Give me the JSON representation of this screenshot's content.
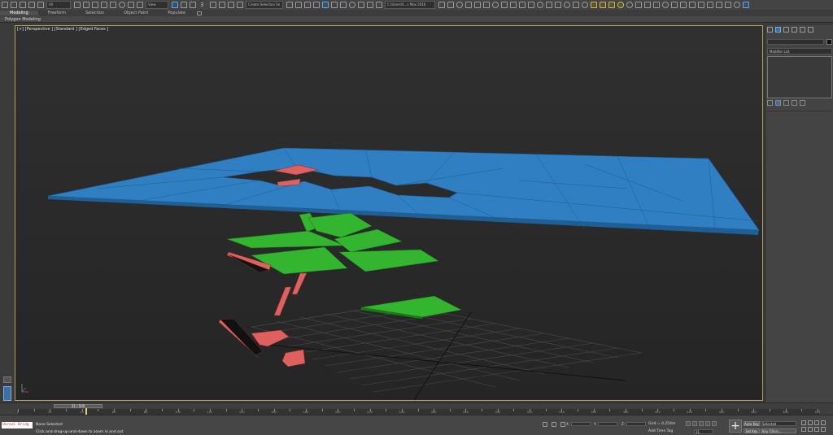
{
  "toolbar": {
    "dropdown_all": "All",
    "dropdown_view": "View",
    "snap_label": "3",
    "selection_set_placeholder": "Create Selection Se",
    "project_path": "C:\\Users\\S...s Max 2016"
  },
  "ribbon": {
    "tabs": [
      "Modeling",
      "Freeform",
      "Selection",
      "Object Paint",
      "Populate"
    ],
    "active_tab": "Modeling",
    "sub_label": "Polygon Modeling"
  },
  "viewport": {
    "label": "[+] [Perspective ] [Standard ] [Edged Faces ]",
    "colors": {
      "blue_plane": "#2f7fc2",
      "green_shards": "#33b52f",
      "red_shards": "#e06060",
      "grid": "#4a4a4a",
      "border_active": "#b5a064"
    }
  },
  "command_panel": {
    "modifier_list": "Modifier List"
  },
  "timeline": {
    "slider_label": "31 / 500",
    "ticks": [
      "0",
      "10",
      "20",
      "30",
      "40",
      "50",
      "60",
      "70",
      "80",
      "90",
      "100",
      "110",
      "120",
      "130",
      "140",
      "150",
      "160",
      "170",
      "180",
      "190",
      "200",
      "210",
      "220",
      "230",
      "240",
      "250",
      "260",
      "270",
      "280",
      "290",
      "300",
      "310",
      "320",
      "330",
      "340",
      "350",
      "360",
      "370",
      "380",
      "390",
      "400",
      "410",
      "420",
      "430",
      "440",
      "450",
      "460",
      "470",
      "480",
      "490",
      "500"
    ]
  },
  "status": {
    "maxscript_label": "Unreal Bridg",
    "selection_status": "None Selected",
    "prompt": "Click and drag-up-and-down to zoom in and out",
    "x_label": "X:",
    "y_label": "Y:",
    "z_label": "Z:",
    "grid_label": "Grid = 0.254m",
    "add_time_tag": "Add Time Tag",
    "frame_value": "31",
    "auto_key": "Auto Key",
    "set_key": "Set Key",
    "selected_dropdown": "Selected",
    "key_filters": "Key Filters..."
  }
}
